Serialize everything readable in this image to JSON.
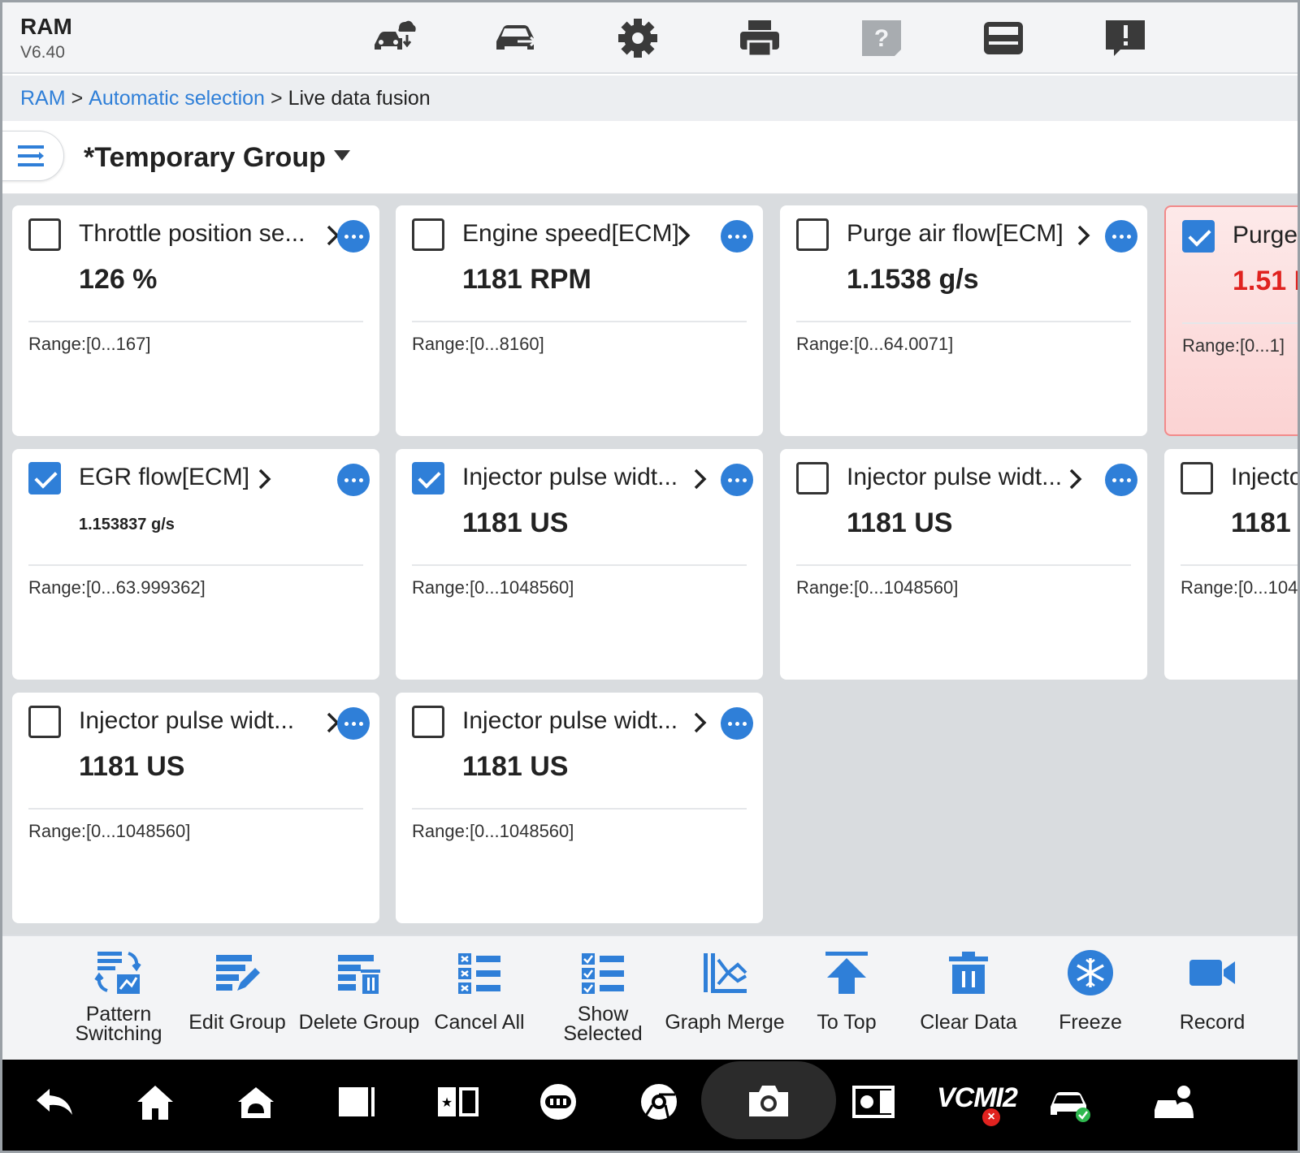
{
  "app": {
    "title": "RAM",
    "version": "V6.40"
  },
  "top_icons": [
    "cloud-car-icon",
    "car-swap-icon",
    "gear-icon",
    "printer-icon",
    "help-icon",
    "folder-icon",
    "feedback-icon"
  ],
  "breadcrumb": {
    "root": "RAM",
    "sep1": ">",
    "middle": "Automatic selection",
    "sep2": ">",
    "current": "Live data fusion"
  },
  "group": {
    "title": "*Temporary Group"
  },
  "cards": [
    {
      "name": "Throttle position se...",
      "value": "126 %",
      "range": "Range:[0...167]",
      "checked": false,
      "alert": false
    },
    {
      "name": "Engine speed[ECM]",
      "value": "1181 RPM",
      "range": "Range:[0...8160]",
      "checked": false,
      "alert": false
    },
    {
      "name": "Purge air flow[ECM]",
      "value": "1.1538 g/s",
      "range": "Range:[0...64.0071]",
      "checked": false,
      "alert": false
    },
    {
      "name": "Purge",
      "value": "1.51 I",
      "range": "Range:[0...1]",
      "checked": true,
      "alert": true
    },
    {
      "name": "EGR flow[ECM]",
      "value": "1.153837 g/s",
      "range": "Range:[0...63.999362]",
      "checked": true,
      "alert": false
    },
    {
      "name": "Injector pulse widt...",
      "value": "1181 US",
      "range": "Range:[0...1048560]",
      "checked": true,
      "alert": false
    },
    {
      "name": "Injector pulse widt...",
      "value": "1181 US",
      "range": "Range:[0...1048560]",
      "checked": false,
      "alert": false
    },
    {
      "name": "Injecto",
      "value": "1181",
      "range": "Range:[0...1048",
      "checked": false,
      "alert": false
    },
    {
      "name": "Injector pulse widt...",
      "value": "1181 US",
      "range": "Range:[0...1048560]",
      "checked": false,
      "alert": false
    },
    {
      "name": "Injector pulse widt...",
      "value": "1181 US",
      "range": "Range:[0...1048560]",
      "checked": false,
      "alert": false
    }
  ],
  "toolbar": [
    {
      "line1": "Pattern",
      "line2": "Switching",
      "icon": "pattern-switch-icon"
    },
    {
      "line1": "Edit Group",
      "icon": "edit-group-icon"
    },
    {
      "line1": "Delete Group",
      "icon": "delete-group-icon"
    },
    {
      "line1": "Cancel All",
      "icon": "cancel-all-icon"
    },
    {
      "line1": "Show",
      "line2": "Selected",
      "icon": "show-selected-icon"
    },
    {
      "line1": "Graph Merge",
      "icon": "graph-merge-icon"
    },
    {
      "line1": "To Top",
      "icon": "to-top-icon"
    },
    {
      "line1": "Clear Data",
      "icon": "trash-icon"
    },
    {
      "line1": "Freeze",
      "icon": "snowflake-icon"
    },
    {
      "line1": "Record",
      "icon": "video-camera-icon"
    }
  ],
  "sysbar": {
    "vci_label": "VCMI2",
    "vci_status_mark": "×"
  },
  "colors": {
    "accent": "#2f7fd8",
    "alert": "#e0221f",
    "alert_bg": "#fbd3d3"
  }
}
